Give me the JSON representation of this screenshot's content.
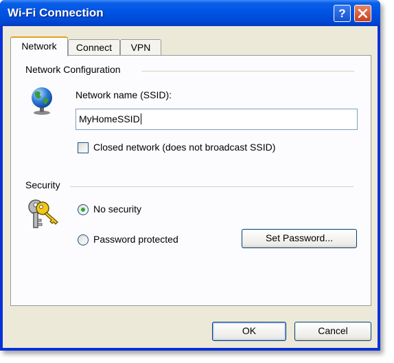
{
  "window": {
    "title": "Wi-Fi Connection"
  },
  "titlebar_buttons": {
    "help_label": "?"
  },
  "tabs": [
    {
      "label": "Network",
      "active": true
    },
    {
      "label": "Connect",
      "active": false
    },
    {
      "label": "VPN",
      "active": false
    }
  ],
  "network_configuration": {
    "group_label": "Network Configuration",
    "ssid_label": "Network name (SSID):",
    "ssid_value": "MyHomeSSID",
    "closed_network_label": "Closed network (does not broadcast SSID)",
    "closed_network_checked": false
  },
  "security": {
    "group_label": "Security",
    "no_security_label": "No security",
    "password_protected_label": "Password protected",
    "selected": "No security",
    "set_password_label": "Set Password..."
  },
  "footer": {
    "ok_label": "OK",
    "cancel_label": "Cancel"
  },
  "icons": [
    "globe-icon",
    "keys-icon",
    "close-icon"
  ],
  "colors": {
    "titlebar": "#0054e3",
    "dialog_bg": "#ece9d8",
    "active_tab_accent": "#e6a020"
  }
}
